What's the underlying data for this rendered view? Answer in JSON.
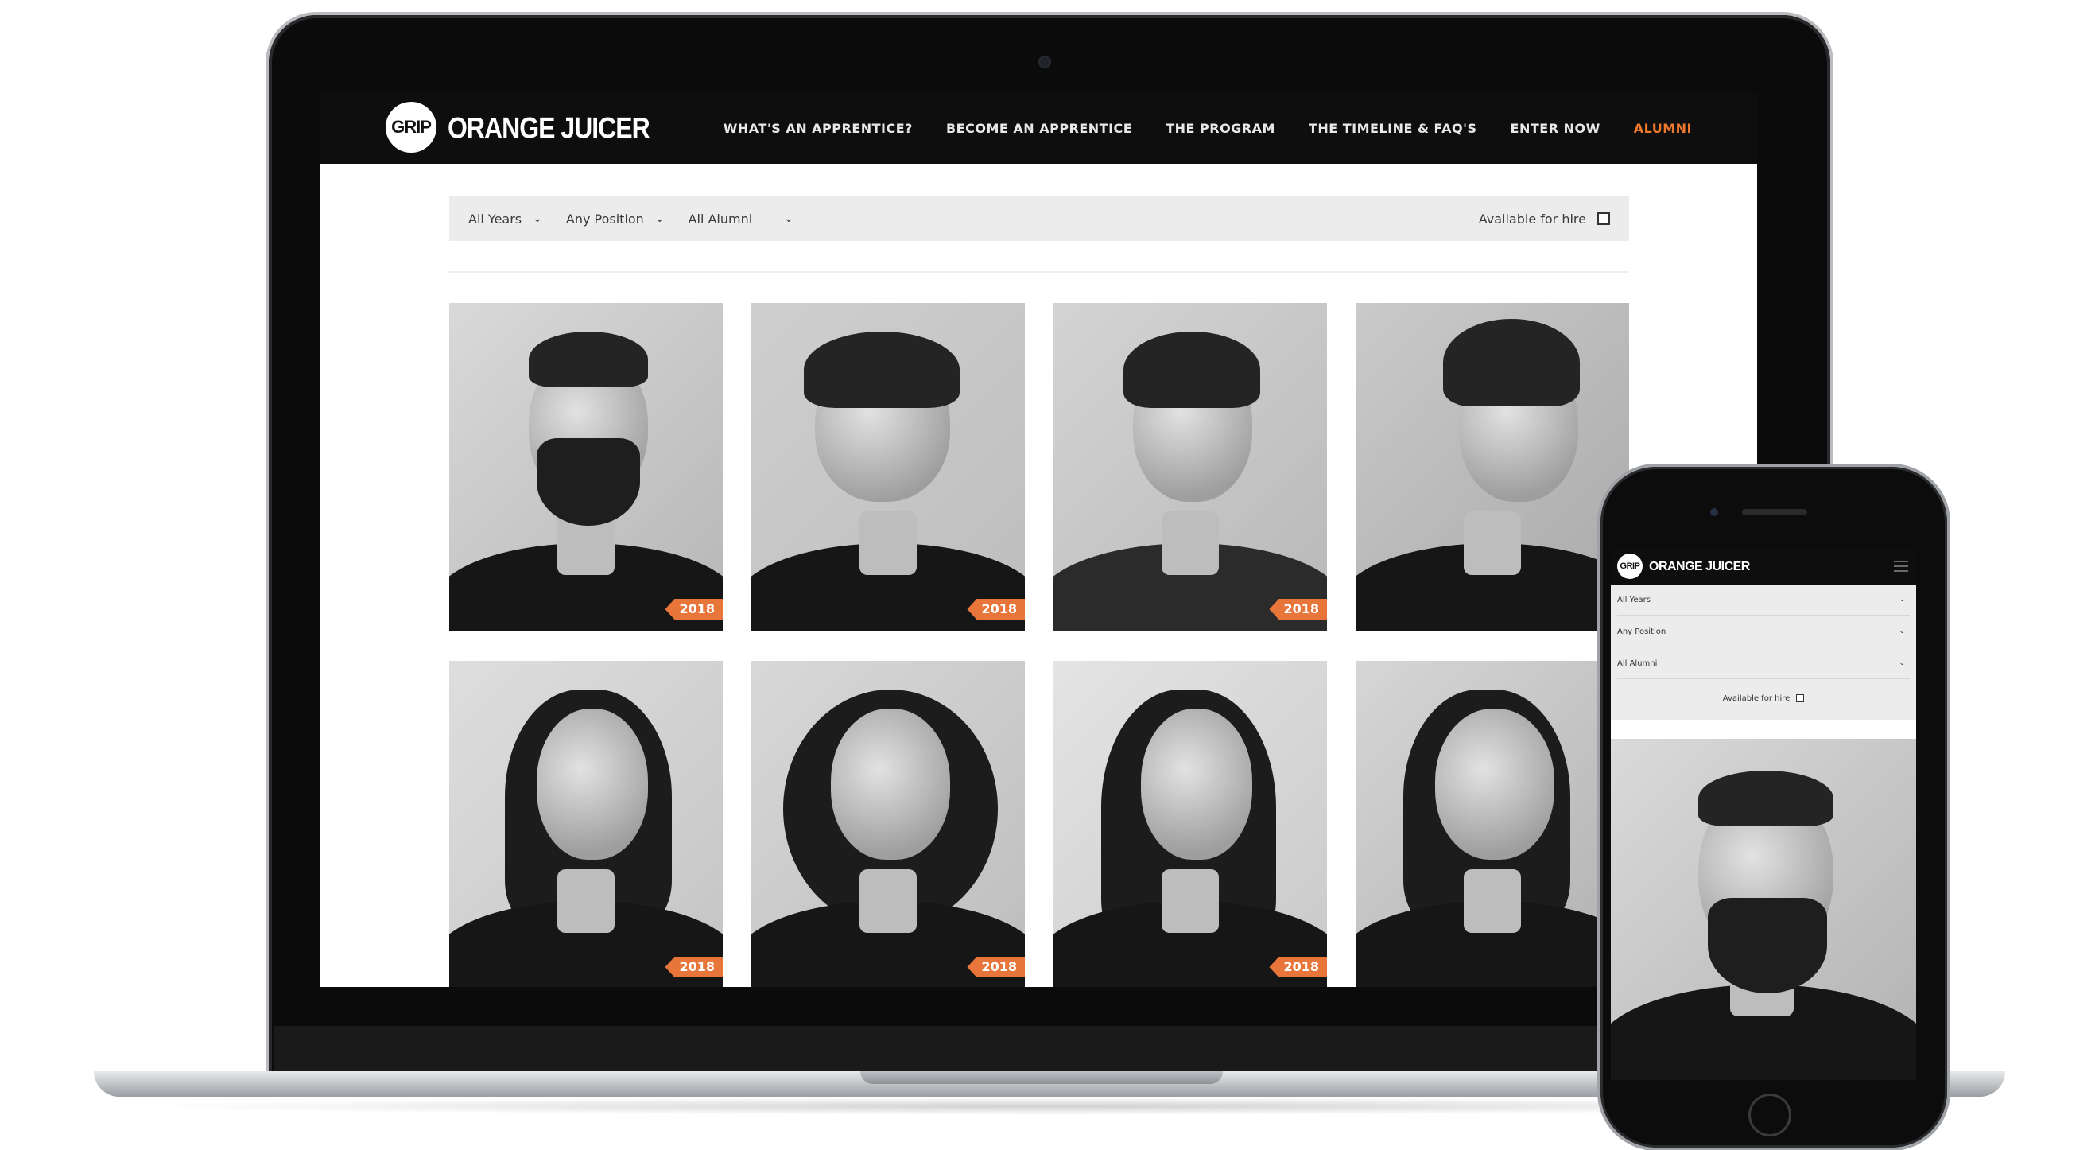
{
  "brand": {
    "logo_badge": "GRIP",
    "logo_text": "ORANGE JUICER"
  },
  "nav": {
    "items": [
      {
        "label": "WHAT'S AN APPRENTICE?"
      },
      {
        "label": "BECOME AN APPRENTICE"
      },
      {
        "label": "THE PROGRAM"
      },
      {
        "label": "THE TIMELINE & FAQ'S"
      },
      {
        "label": "ENTER NOW"
      },
      {
        "label": "ALUMNI",
        "active": true
      }
    ]
  },
  "filters": {
    "years": "All Years",
    "position": "Any Position",
    "alumni": "All Alumni",
    "available_for_hire": "Available for hire",
    "chevron": "chevron-down-icon"
  },
  "alumni": [
    {
      "year": "2018"
    },
    {
      "year": "2018"
    },
    {
      "year": "2018"
    },
    {
      "year": ""
    },
    {
      "year": "2018"
    },
    {
      "year": "2018"
    },
    {
      "year": "2018"
    },
    {
      "year": ""
    }
  ],
  "mobile": {
    "logo_badge": "GRIP",
    "logo_text": "ORANGE JUICER",
    "filters": [
      "All Years",
      "Any Position",
      "All Alumni"
    ],
    "available_for_hire": "Available for hire"
  },
  "colors": {
    "accent": "#f0782c",
    "tag": "#e8753a",
    "header": "#0e0e0f",
    "filter_bg": "#ececec"
  }
}
